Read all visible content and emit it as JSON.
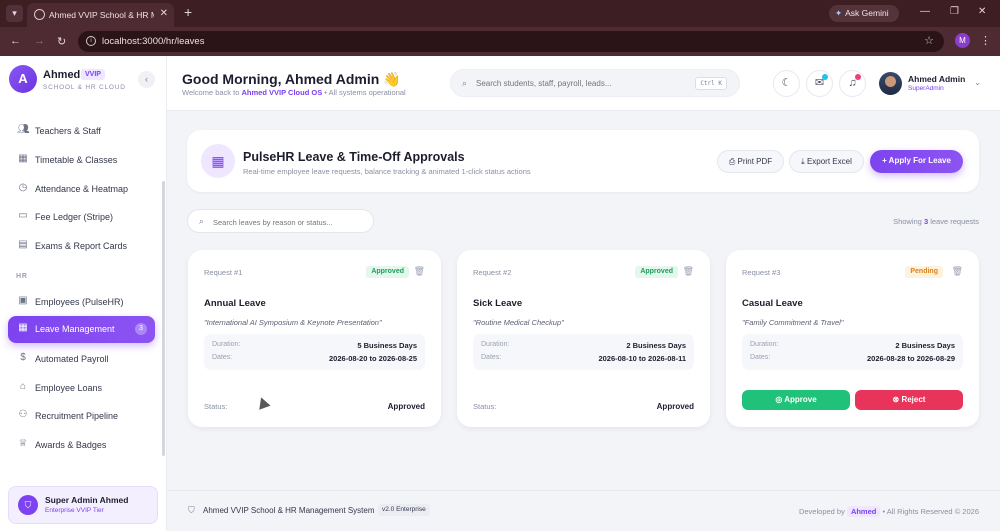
{
  "browser": {
    "tab_title": "Ahmed VVIP School & HR Man",
    "tab_close": "✕",
    "new_tab": "+",
    "gemini_label": "Ask Gemini",
    "url": "localhost:3000/hr/leaves",
    "profile_initial": "M"
  },
  "brand": {
    "name": "Ahmed",
    "badge": "VVIP",
    "subtitle": "SCHOOL & HR CLOUD",
    "logo_letter": "A"
  },
  "sidebar": {
    "items": [
      {
        "label": "Teachers & Staff",
        "icon": "users-icon"
      },
      {
        "label": "Timetable & Classes",
        "icon": "calendar-icon"
      },
      {
        "label": "Attendance & Heatmap",
        "icon": "clock-icon"
      },
      {
        "label": "Fee Ledger (Stripe)",
        "icon": "card-icon"
      },
      {
        "label": "Exams & Report Cards",
        "icon": "clipboard-icon"
      }
    ],
    "section_hr": "HR",
    "hr_items": [
      {
        "label": "Employees (PulseHR)",
        "icon": "briefcase-icon"
      },
      {
        "label": "Leave Management",
        "icon": "calendar-icon",
        "count": "3"
      },
      {
        "label": "Automated Payroll",
        "icon": "dollar-icon"
      },
      {
        "label": "Employee Loans",
        "icon": "bank-icon"
      },
      {
        "label": "Recruitment Pipeline",
        "icon": "user-plus-icon"
      },
      {
        "label": "Awards & Badges",
        "icon": "trophy-icon"
      }
    ],
    "admin_card": {
      "name": "Super Admin Ahmed",
      "tier": "Enterprise VVIP Tier"
    }
  },
  "header": {
    "greeting": "Good Morning, Ahmed Admin 👋",
    "welcome_prefix": "Welcome back to",
    "welcome_brand": "Ahmed VVIP Cloud OS",
    "welcome_suffix": "• All systems operational",
    "search_placeholder": "Search students, staff, payroll, leads...",
    "search_shortcut": "Ctrl K",
    "user_name": "Ahmed Admin",
    "user_role": "SuperAdmin"
  },
  "page": {
    "title": "PulseHR Leave & Time-Off Approvals",
    "subtitle": "Real-time employee leave requests, balance tracking & animated 1-click status actions",
    "print_label": "Print PDF",
    "export_label": "Export Excel",
    "apply_label": "Apply For Leave",
    "search_placeholder": "Search leaves by reason or status...",
    "showing_prefix": "Showing",
    "showing_count": "3",
    "showing_suffix": "leave requests"
  },
  "leave_labels": {
    "duration": "Duration:",
    "dates": "Dates:",
    "status": "Status:",
    "approve": "Approve",
    "reject": "Reject"
  },
  "requests": [
    {
      "id": "Request #1",
      "badge": "Approved",
      "type": "Annual Leave",
      "reason": "\"International AI Symposium & Keynote Presentation\"",
      "duration": "5 Business Days",
      "dates": "2026-08-20 to 2026-08-25",
      "status": "Approved"
    },
    {
      "id": "Request #2",
      "badge": "Approved",
      "type": "Sick Leave",
      "reason": "\"Routine Medical Checkup\"",
      "duration": "2 Business Days",
      "dates": "2026-08-10 to 2026-08-11",
      "status": "Approved"
    },
    {
      "id": "Request #3",
      "badge": "Pending",
      "type": "Casual Leave",
      "reason": "\"Family Commitment & Travel\"",
      "duration": "2 Business Days",
      "dates": "2026-08-28 to 2026-08-29",
      "status": "Pending"
    }
  ],
  "footer": {
    "system": "Ahmed VVIP School & HR Management System",
    "version": "v2.0 Enterprise",
    "dev_prefix": "Developed by",
    "dev_name": "Ahmed",
    "dev_suffix": "• All Rights Reserved © 2026"
  }
}
